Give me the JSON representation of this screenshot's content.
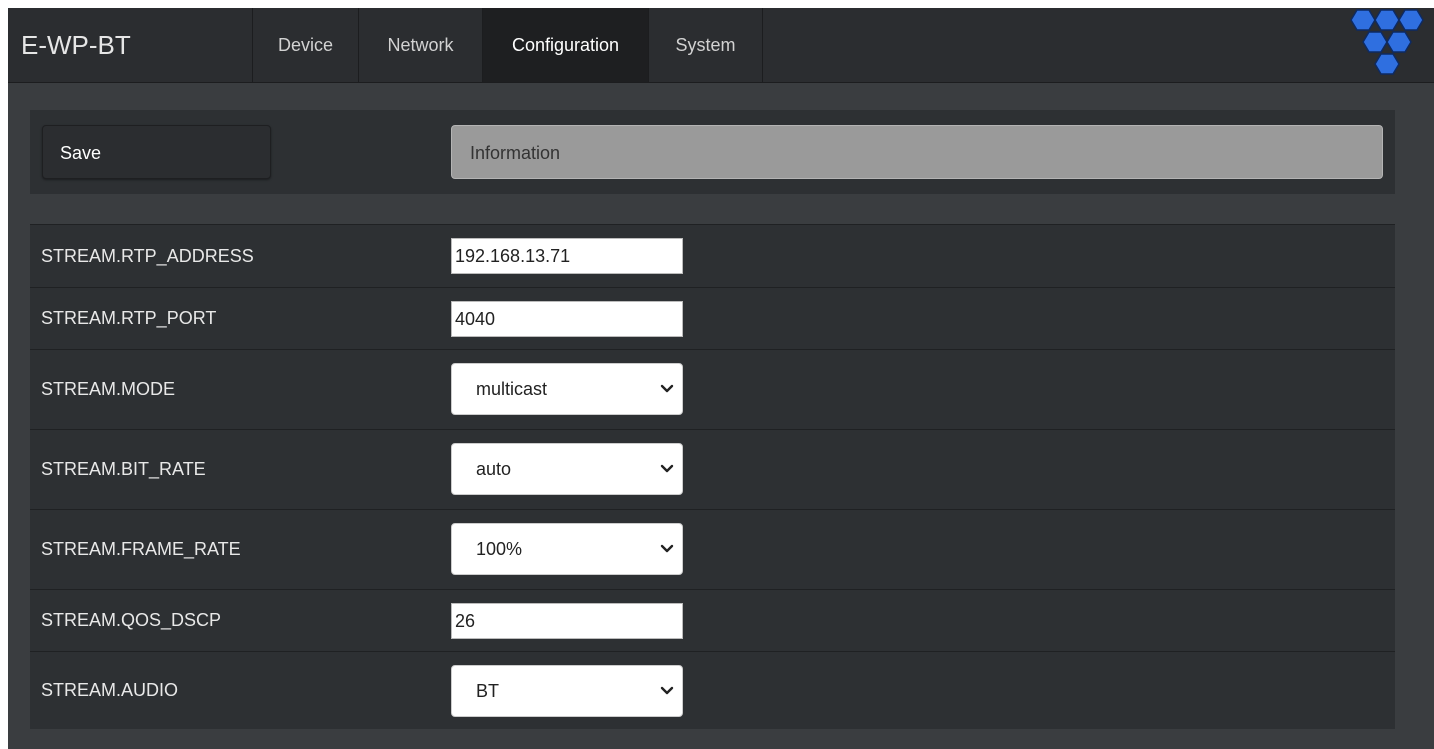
{
  "navbar": {
    "brand": "E-WP-BT",
    "tabs": [
      {
        "label": "Device",
        "active": false
      },
      {
        "label": "Network",
        "active": false
      },
      {
        "label": "Configuration",
        "active": true
      },
      {
        "label": "System",
        "active": false
      }
    ],
    "logo_icon": "hexagon-cluster-logo",
    "logo_color": "#2f6fe0"
  },
  "toolbar": {
    "save_label": "Save",
    "info_placeholder": "Information"
  },
  "settings": {
    "rows": [
      {
        "label": "STREAM.RTP_ADDRESS",
        "type": "text",
        "value": "192.168.13.71"
      },
      {
        "label": "STREAM.RTP_PORT",
        "type": "text",
        "value": "4040"
      },
      {
        "label": "STREAM.MODE",
        "type": "select",
        "value": "multicast"
      },
      {
        "label": "STREAM.BIT_RATE",
        "type": "select",
        "value": "auto"
      },
      {
        "label": "STREAM.FRAME_RATE",
        "type": "select",
        "value": "100%"
      },
      {
        "label": "STREAM.QOS_DSCP",
        "type": "text",
        "value": "26"
      },
      {
        "label": "STREAM.AUDIO",
        "type": "select",
        "value": "BT"
      }
    ]
  },
  "colors": {
    "page_bg": "#3a3d40",
    "navbar_bg": "#2b2d30",
    "active_tab_bg": "#1e1f21",
    "panel_bg": "#2d3033",
    "info_bg": "#9a9a9a"
  }
}
